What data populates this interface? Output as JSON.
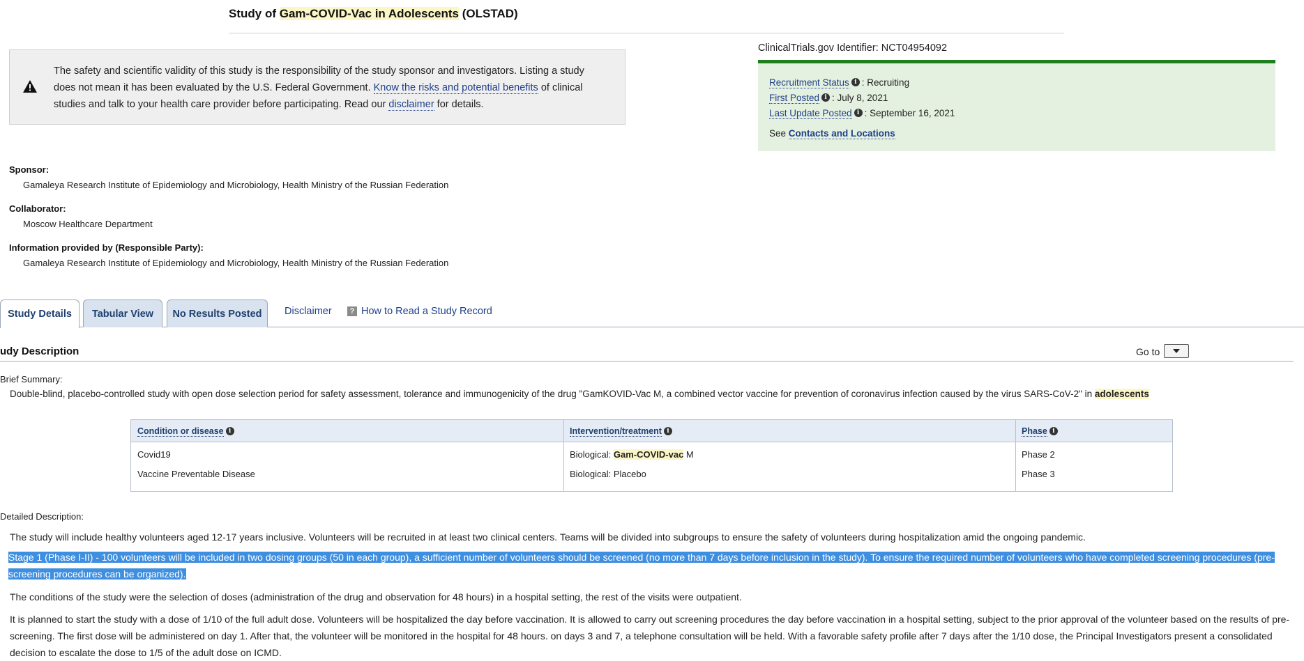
{
  "title": {
    "prefix": "Study of ",
    "highlight": "Gam-COVID-Vac in Adolescents",
    "suffix": " (OLSTAD)"
  },
  "warning": {
    "line1": "The safety and scientific validity of this study is the responsibility of the study sponsor and investigators. Listing a study",
    "line2_a": "does not mean it has been evaluated by the U.S. Federal Government. ",
    "line2_link": "Know the risks and potential benefits",
    "line2_b": " of clinical",
    "line3_a": "studies and talk to your health care provider before participating. Read our ",
    "line3_link": "disclaimer",
    "line3_b": " for details."
  },
  "identifier": "ClinicalTrials.gov Identifier: NCT04954092",
  "status": {
    "recruitment_label": "Recruitment Status",
    "recruitment_value": ": Recruiting",
    "first_posted_label": "First Posted",
    "first_posted_value": ": July 8, 2021",
    "last_update_label": "Last Update Posted",
    "last_update_value": ": September 16, 2021",
    "see": "See ",
    "contacts_link": "Contacts and Locations"
  },
  "sponsor": {
    "sponsor_label": "Sponsor:",
    "sponsor_value": "Gamaleya Research Institute of Epidemiology and Microbiology, Health Ministry of the Russian Federation",
    "collaborator_label": "Collaborator:",
    "collaborator_value": "Moscow Healthcare Department",
    "info_label": "Information provided by (Responsible Party):",
    "info_value": "Gamaleya Research Institute of Epidemiology and Microbiology, Health Ministry of the Russian Federation"
  },
  "tabs": {
    "details": "Study Details",
    "tabular": "Tabular View",
    "results": "No Results Posted",
    "disclaimer": "Disclaimer",
    "how_read": "How to Read a Study Record"
  },
  "study_description": {
    "heading": "udy Description",
    "goto": "Go to",
    "brief_label": "Brief Summary:",
    "brief_text": "Double-blind, placebo-controlled study with open dose selection period for safety assessment, tolerance and immunogenicity of the drug \"GamKOVID-Vac M, a combined vector vaccine for prevention of coronavirus infection caused by the virus SARS-CoV-2\" in ",
    "brief_highlight": "adolescents"
  },
  "table": {
    "headers": [
      "Condition or disease",
      "Intervention/treatment",
      "Phase"
    ],
    "rows": [
      {
        "condition": "Covid19",
        "intervention_prefix": "Biological: ",
        "intervention_highlight": "Gam-COVID-vac",
        "intervention_suffix": " M",
        "phase": "Phase 2"
      },
      {
        "condition": "Vaccine Preventable Disease",
        "intervention_prefix": "Biological: Placebo",
        "intervention_highlight": "",
        "intervention_suffix": "",
        "phase": "Phase 3"
      }
    ]
  },
  "detailed": {
    "label": "Detailed Description:",
    "p1": "The study will include healthy volunteers aged 12-17 years inclusive. Volunteers will be recruited in at least two clinical centers. Teams will be divided into subgroups to ensure the safety of volunteers during hospitalization amid the ongoing pandemic.",
    "p2_line1": "Stage 1 (Phase I-II) - 100 volunteers will be included in two dosing groups (50 in each group), a sufficient number of volunteers should be screened (no more than 7 days before inclusion in the study). To ensure the required number of volunteers who have completed screening procedures (pre-",
    "p2_line2": "screening procedures can be organized).",
    "p3": "The conditions of the study were the selection of doses (administration of the drug and observation for 48 hours) in a hospital setting, the rest of the visits were outpatient.",
    "p4_line1": "It is planned to start the study with a dose of 1/10 of the full adult dose. Volunteers will be hospitalized the day before vaccination. It is allowed to carry out screening procedures the day before vaccination in a hospital setting, subject to the prior approval of the volunteer based on the results of pre-",
    "p4_line2": "screening. The first dose will be administered on day 1. After that, the volunteer will be monitored in the hospital for 48 hours. on days 3 and 7, a telephone consultation will be held. With a favorable safety profile after 7 days after the 1/10 dose, the Principal Investigators present a consolidated",
    "p4_line3": "decision to escalate the dose to 1/5 of the adult dose on ICMD."
  }
}
